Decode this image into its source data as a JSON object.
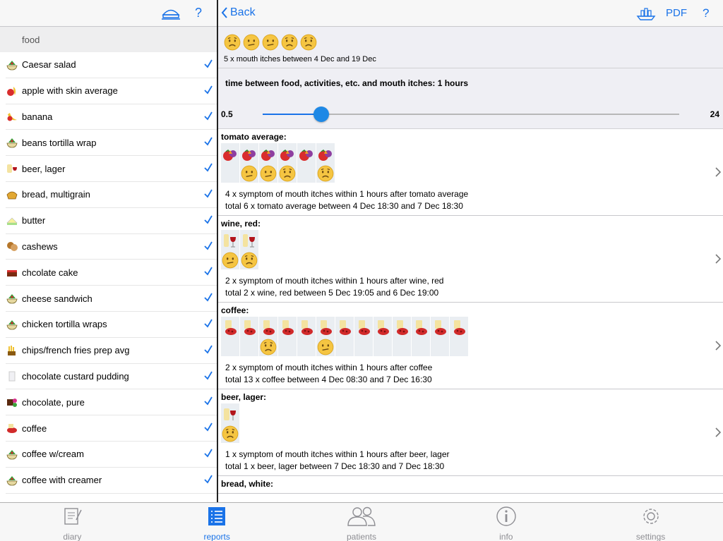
{
  "left": {
    "section": "food",
    "items": [
      {
        "label": "Caesar salad",
        "icon": "salad-bowl-icon"
      },
      {
        "label": "apple with skin average",
        "icon": "apple-icon"
      },
      {
        "label": "banana",
        "icon": "banana-icon"
      },
      {
        "label": "beans tortilla wrap",
        "icon": "salad-bowl-icon"
      },
      {
        "label": "beer, lager",
        "icon": "beer-icon"
      },
      {
        "label": "bread, multigrain",
        "icon": "bread-icon"
      },
      {
        "label": "butter",
        "icon": "butter-icon"
      },
      {
        "label": "cashews",
        "icon": "nuts-icon"
      },
      {
        "label": "chcolate cake",
        "icon": "cake-icon"
      },
      {
        "label": "cheese sandwich",
        "icon": "salad-bowl-icon"
      },
      {
        "label": "chicken tortilla wraps",
        "icon": "salad-bowl-icon"
      },
      {
        "label": "chips/french fries prep avg",
        "icon": "fries-icon"
      },
      {
        "label": "chocolate custard pudding",
        "icon": "milk-icon"
      },
      {
        "label": "chocolate, pure",
        "icon": "chocolate-icon"
      },
      {
        "label": "coffee",
        "icon": "coffee-icon"
      },
      {
        "label": "coffee w/cream",
        "icon": "salad-bowl-icon"
      },
      {
        "label": "coffee with creamer",
        "icon": "salad-bowl-icon"
      }
    ]
  },
  "header": {
    "back": "Back",
    "pdf": "PDF",
    "help": "?"
  },
  "summary": {
    "text": "5 x mouth itches between 4 Dec and 19 Dec",
    "faces": [
      "worried",
      "confused",
      "confused",
      "worried",
      "worried"
    ]
  },
  "time": {
    "title": "time between food, activities, etc. and mouth itches: 1 hours",
    "min": "0.5",
    "max": "24",
    "value_fraction": 0.14
  },
  "blocks": [
    {
      "name": "tomato average:",
      "columns": [
        [
          "tomato",
          "none"
        ],
        [
          "tomato",
          "confused"
        ],
        [
          "tomato",
          "confused"
        ],
        [
          "tomato",
          "worried"
        ],
        [
          "tomato",
          "none"
        ],
        [
          "tomato",
          "worried"
        ]
      ],
      "line1": "4 x  symptom of mouth itches within 1 hours after tomato average",
      "line2": "total 6 x tomato average between 4 Dec 18:30 and 7 Dec 18:30"
    },
    {
      "name": "wine, red:",
      "columns": [
        [
          "wine",
          "confused"
        ],
        [
          "wine",
          "worried"
        ]
      ],
      "line1": "2 x  symptom of mouth itches within 1 hours after wine, red",
      "line2": "total 2 x wine, red between 5 Dec 19:05 and 6 Dec 19:00"
    },
    {
      "name": "coffee:",
      "columns": [
        [
          "coffee",
          "none"
        ],
        [
          "coffee",
          "none"
        ],
        [
          "coffee",
          "worried"
        ],
        [
          "coffee",
          "none"
        ],
        [
          "coffee",
          "none"
        ],
        [
          "coffee",
          "confused"
        ],
        [
          "coffee",
          "none"
        ],
        [
          "coffee",
          "none"
        ],
        [
          "coffee",
          "none"
        ],
        [
          "coffee",
          "none"
        ],
        [
          "coffee",
          "none"
        ],
        [
          "coffee",
          "none"
        ],
        [
          "coffee",
          "none"
        ]
      ],
      "line1": "2 x  symptom of mouth itches within 1 hours after coffee",
      "line2": "total 13 x coffee between 4 Dec 08:30 and 7 Dec 16:30"
    },
    {
      "name": "beer, lager:",
      "columns": [
        [
          "beer",
          "worried"
        ]
      ],
      "line1": "1 x  symptom of mouth itches within 1 hours after beer, lager",
      "line2": "total 1 x beer, lager between 7 Dec 18:30 and 7 Dec 18:30"
    },
    {
      "name": "bread, white:",
      "columns": [],
      "line1": "",
      "line2": ""
    }
  ],
  "tabs": [
    {
      "label": "diary",
      "icon": "diary-icon",
      "active": false
    },
    {
      "label": "reports",
      "icon": "reports-icon",
      "active": true
    },
    {
      "label": "patients",
      "icon": "patients-icon",
      "active": false
    },
    {
      "label": "info",
      "icon": "info-icon",
      "active": false
    },
    {
      "label": "settings",
      "icon": "settings-icon",
      "active": false
    }
  ],
  "colors": {
    "accent": "#1a73e8",
    "face": "#f5c542"
  }
}
